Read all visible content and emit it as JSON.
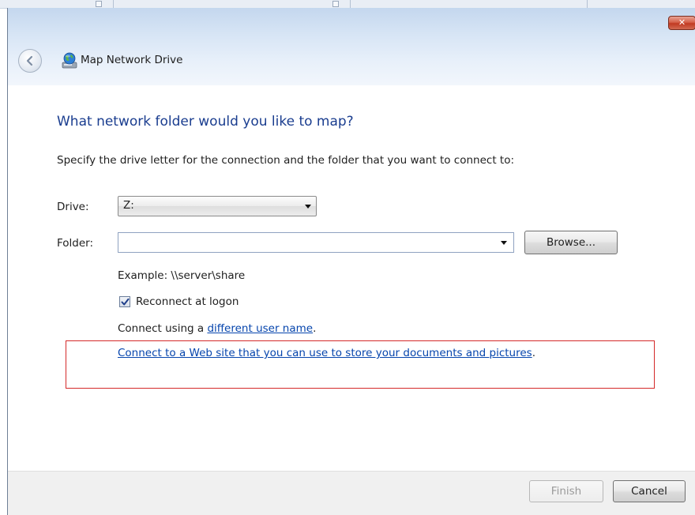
{
  "dialog": {
    "title": "Map Network Drive",
    "close_glyph": "✕",
    "icons": {
      "back": "back-arrow-icon",
      "title": "network-drive-globe-icon",
      "close": "close-icon",
      "dropdown": "chevron-down-icon",
      "check": "checkmark-icon"
    },
    "colors": {
      "heading": "#1a3d8f",
      "link": "#0645ad",
      "highlight": "#d42a2a"
    }
  },
  "content": {
    "heading": "What network folder would you like to map?",
    "intro": "Specify the drive letter for the connection and the folder that you want to connect to:",
    "drive_label": "Drive:",
    "drive_value": "Z:",
    "folder_label": "Folder:",
    "folder_value": "",
    "browse_label": "Browse...",
    "example_text": "Example: \\\\server\\share",
    "reconnect_label": "Reconnect at logon",
    "reconnect_checked": true,
    "connect_prefix": "Connect using a ",
    "different_user_link": "different user name",
    "connect_suffix": ".",
    "web_link": "Connect to a Web site that you can use to store your documents and pictures",
    "web_suffix": "."
  },
  "footer": {
    "finish_label": "Finish",
    "cancel_label": "Cancel"
  }
}
